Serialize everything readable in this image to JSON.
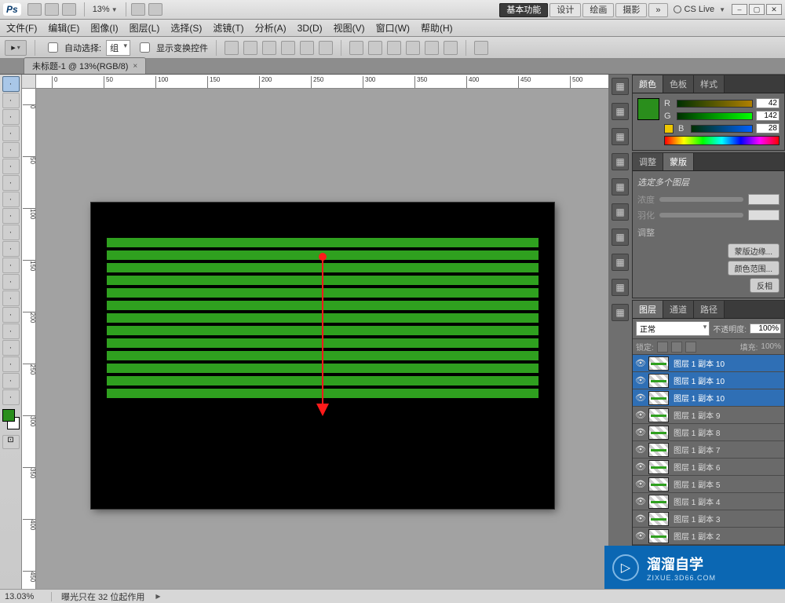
{
  "appbar": {
    "logo": "Ps",
    "zoom_combo": "13%",
    "workspace_buttons": [
      "基本功能",
      "设计",
      "绘画",
      "摄影",
      "»"
    ],
    "workspace_active": 0,
    "cslive": "CS Live"
  },
  "menus": [
    "文件(F)",
    "编辑(E)",
    "图像(I)",
    "图层(L)",
    "选择(S)",
    "滤镜(T)",
    "分析(A)",
    "3D(D)",
    "视图(V)",
    "窗口(W)",
    "帮助(H)"
  ],
  "options": {
    "auto_select_label": "自动选择:",
    "auto_select_value": "组",
    "show_transform_label": "显示变换控件"
  },
  "doc_tab": {
    "title": "未标题-1 @ 13%(RGB/8)"
  },
  "ruler_ticks_h": [
    "0",
    "50",
    "100",
    "150",
    "200",
    "250",
    "300",
    "350",
    "400",
    "450",
    "500"
  ],
  "ruler_ticks_v": [
    "0",
    "50",
    "100",
    "150",
    "200",
    "250",
    "300",
    "350",
    "400",
    "450"
  ],
  "toolbox_tools": [
    "move",
    "marquee",
    "lasso",
    "wand",
    "crop",
    "eyedrop",
    "heal",
    "brush",
    "stamp",
    "history",
    "eraser",
    "gradient",
    "blur",
    "dodge",
    "pen",
    "type",
    "path",
    "rect",
    "hand",
    "zoom"
  ],
  "dock_icons": [
    "nav",
    "swatch",
    "brush",
    "adjust",
    "char",
    "para",
    "clone",
    "tool",
    "3d",
    "A|"
  ],
  "panels": {
    "color": {
      "tabs": [
        "颜色",
        "色板",
        "样式"
      ],
      "active": 0,
      "rgb": {
        "R": "42",
        "G": "142",
        "B": "28"
      },
      "swatch_hex": "#2a8e1c"
    },
    "adjust": {
      "tabs": [
        "调整",
        "蒙版"
      ],
      "active": 1,
      "note": "选定多个图层",
      "rows": [
        "浓度",
        "羽化"
      ],
      "section": "调整",
      "buttons": [
        "蒙版边缘...",
        "颜色范围...",
        "反相"
      ]
    },
    "layers": {
      "tabs": [
        "图层",
        "通道",
        "路径"
      ],
      "active": 0,
      "blend": "正常",
      "opacity_label": "不透明度:",
      "opacity": "100%",
      "lock_label": "锁定:",
      "fill_label": "填充:",
      "fill": "100%",
      "items": [
        {
          "name": "图层 1 副本 10",
          "sel": true
        },
        {
          "name": "图层 1 副本 10",
          "sel": true
        },
        {
          "name": "图层 1 副本 10",
          "sel": true
        },
        {
          "name": "图层 1 副本 9",
          "sel": false
        },
        {
          "name": "图层 1 副本 8",
          "sel": false
        },
        {
          "name": "图层 1 副本 7",
          "sel": false
        },
        {
          "name": "图层 1 副本 6",
          "sel": false
        },
        {
          "name": "图层 1 副本 5",
          "sel": false
        },
        {
          "name": "图层 1 副本 4",
          "sel": false
        },
        {
          "name": "图层 1 副本 3",
          "sel": false
        },
        {
          "name": "图层 1 副本 2",
          "sel": false
        }
      ]
    }
  },
  "status": {
    "zoom": "13.03%",
    "info": "曝光只在 32 位起作用"
  },
  "watermark": {
    "brand": "溜溜自学",
    "sub": "ZIXUE.3D66.COM",
    "glyph": "▷"
  },
  "canvas": {
    "stripe_count": 13,
    "stripe_color": "#2fa01f",
    "bg": "#000000"
  }
}
